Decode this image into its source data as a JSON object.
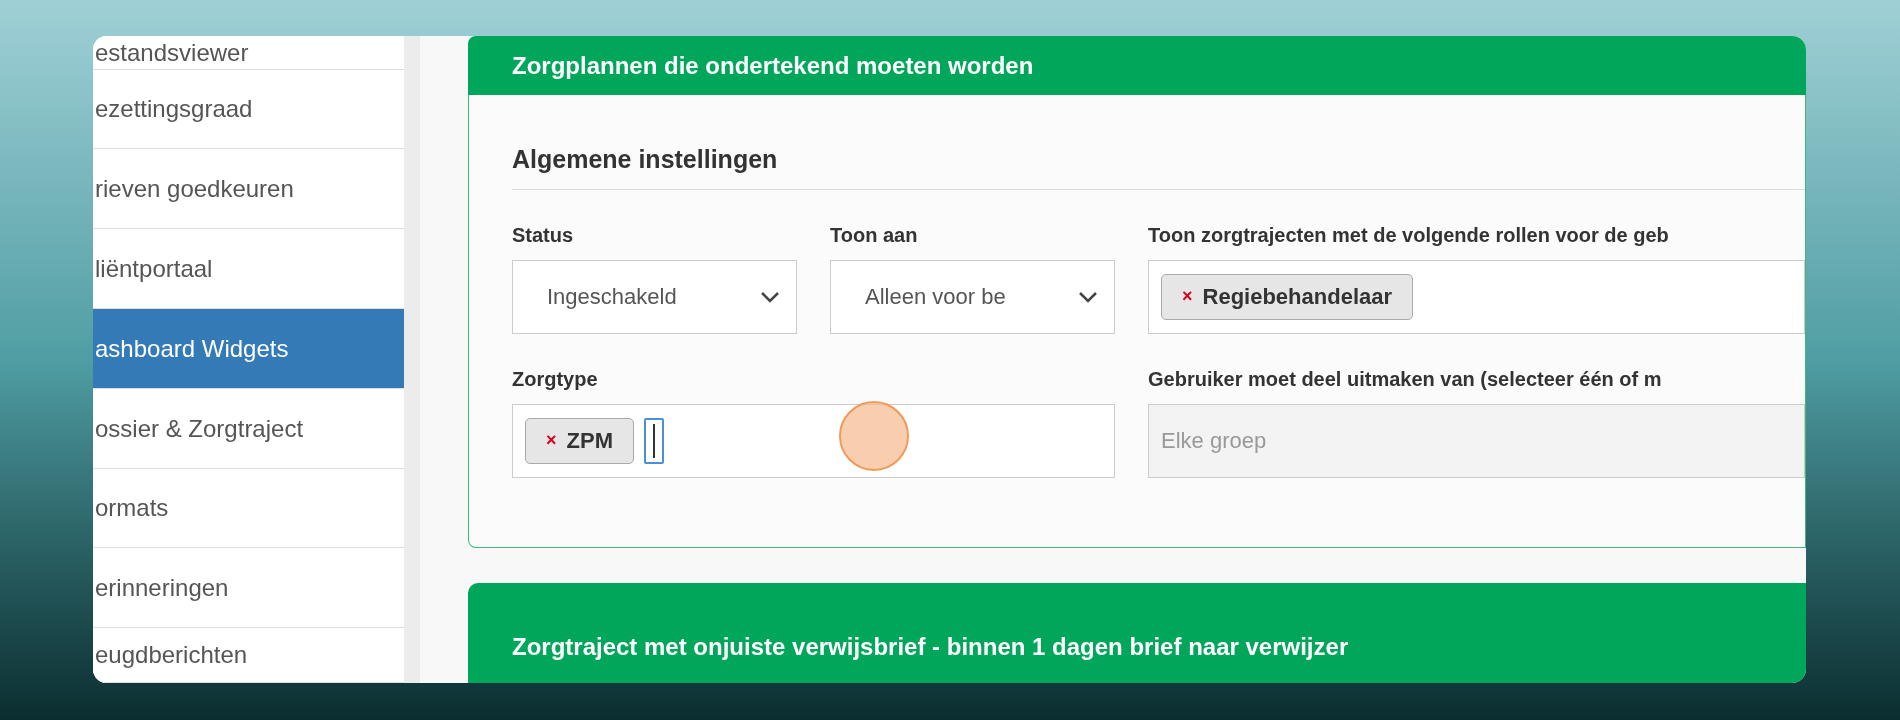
{
  "sidebar": {
    "items": [
      {
        "label": "estandsviewer",
        "selected": false
      },
      {
        "label": "ezettingsgraad",
        "selected": false
      },
      {
        "label": "rieven goedkeuren",
        "selected": false
      },
      {
        "label": "liëntportaal",
        "selected": false
      },
      {
        "label": "ashboard Widgets",
        "selected": true
      },
      {
        "label": "ossier & Zorgtraject",
        "selected": false
      },
      {
        "label": "ormats",
        "selected": false
      },
      {
        "label": "erinneringen",
        "selected": false
      },
      {
        "label": "eugdberichten",
        "selected": false
      }
    ]
  },
  "panels": [
    {
      "title": "Zorgplannen die ondertekend moeten worden",
      "section": {
        "heading": "Algemene instellingen",
        "fields": [
          {
            "kind": "select",
            "label": "Status",
            "value": "Ingeschakeld"
          },
          {
            "kind": "select",
            "label": "Toon aan",
            "value": "Alleen voor be"
          },
          {
            "kind": "tags",
            "label": "Toon zorgtrajecten met de volgende rollen voor de geb",
            "tags": [
              {
                "remove": "×",
                "label": "Regiebehandelaar"
              }
            ],
            "focused": false
          },
          {
            "kind": "tags",
            "label": "Zorgtype",
            "tags": [
              {
                "remove": "×",
                "label": "ZPM"
              }
            ],
            "focused": true
          },
          {
            "kind": "tags",
            "label": "Gebruiker moet deel uitmaken van (selecteer één of m",
            "placeholder": "Elke groep",
            "focused": false
          }
        ]
      }
    },
    {
      "title": "Zorgtraject met onjuiste verwijsbrief - binnen 1 dagen brief naar verwijzer"
    }
  ]
}
